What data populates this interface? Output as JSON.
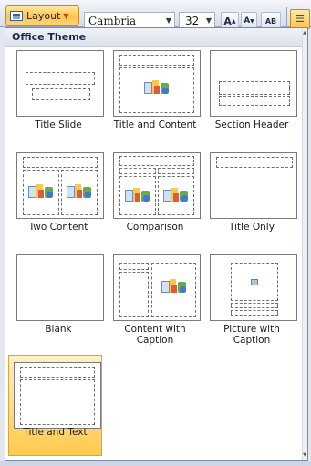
{
  "ribbon": {
    "layout_label": "Layout",
    "font_name": "Cambria",
    "font_size": "32",
    "grow_label": "A",
    "shrink_label": "A",
    "clear_label": "AB"
  },
  "gallery": {
    "header": "Office Theme",
    "layouts": [
      {
        "label": "Title Slide"
      },
      {
        "label": "Title and Content"
      },
      {
        "label": "Section Header"
      },
      {
        "label": "Two Content"
      },
      {
        "label": "Comparison"
      },
      {
        "label": "Title Only"
      },
      {
        "label": "Blank"
      },
      {
        "label": "Content with Caption"
      },
      {
        "label": "Picture with Caption"
      },
      {
        "label": "Title and Text",
        "selected": true
      }
    ]
  },
  "colors": {
    "selected_fill": "#ffd56e",
    "selected_border": "#d9a441",
    "placeholder_border": "#6f6f6f"
  }
}
